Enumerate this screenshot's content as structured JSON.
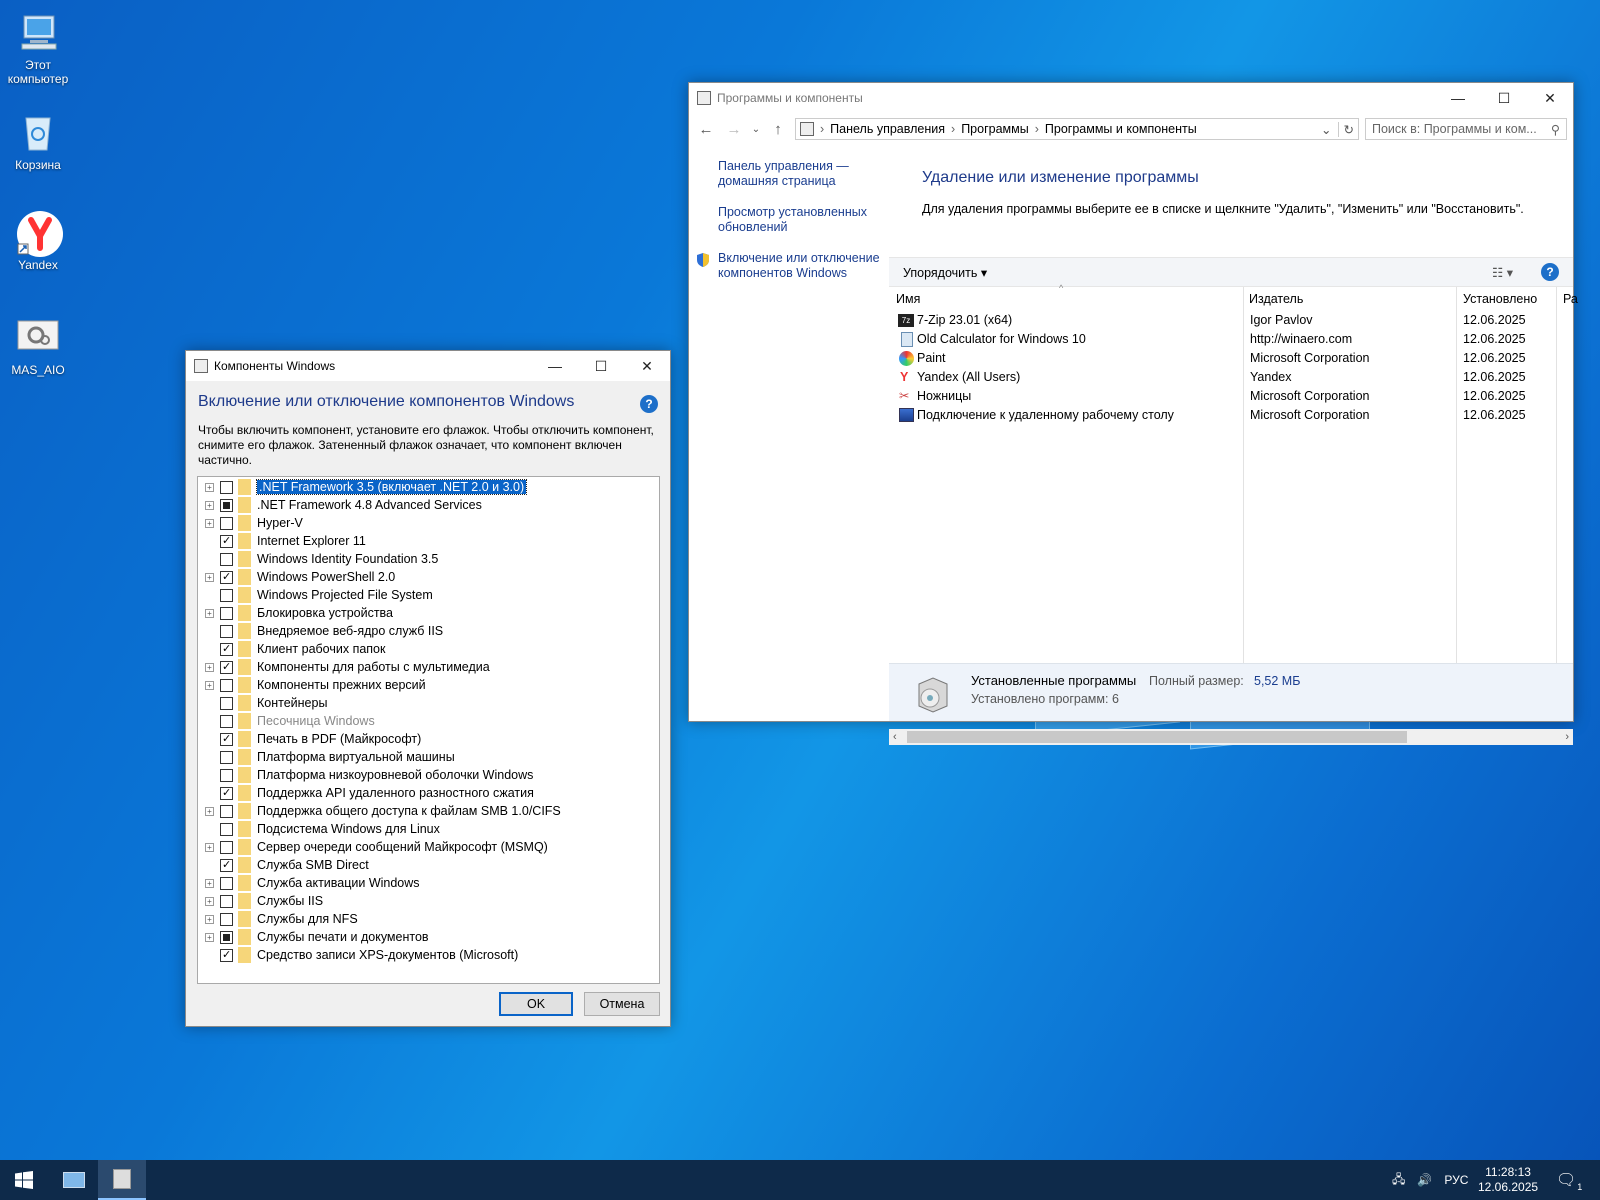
{
  "desktop": {
    "icons": [
      {
        "label": "Этот компьютер",
        "icon": "computer-icon"
      },
      {
        "label": "Корзина",
        "icon": "recycle-bin-icon"
      },
      {
        "label": "Yandex",
        "icon": "yandex-icon"
      },
      {
        "label": "MAS_AIO",
        "icon": "settings-file-icon"
      }
    ]
  },
  "programs_window": {
    "title": "Программы и компоненты",
    "breadcrumb": [
      "Панель управления",
      "Программы",
      "Программы и компоненты"
    ],
    "search_placeholder": "Поиск в: Программы и ком...",
    "left_links": [
      "Панель управления — домашняя страница",
      "Просмотр установленных обновлений",
      "Включение или отключение компонентов Windows"
    ],
    "heading": "Удаление или изменение программы",
    "description": "Для удаления программы выберите ее в списке и щелкните \"Удалить\", \"Изменить\" или \"Восстановить\".",
    "organize_label": "Упорядочить",
    "columns": [
      "Имя",
      "Издатель",
      "Установлено",
      "Ра"
    ],
    "rows": [
      {
        "name": "7-Zip 23.01 (x64)",
        "publisher": "Igor Pavlov",
        "date": "12.06.2025",
        "icon": "7zip-icon"
      },
      {
        "name": "Old Calculator for Windows 10",
        "publisher": "http://winaero.com",
        "date": "12.06.2025",
        "icon": "calculator-icon"
      },
      {
        "name": "Paint",
        "publisher": "Microsoft Corporation",
        "date": "12.06.2025",
        "icon": "paint-icon"
      },
      {
        "name": "Yandex (All Users)",
        "publisher": "Yandex",
        "date": "12.06.2025",
        "icon": "yandex-icon"
      },
      {
        "name": "Ножницы",
        "publisher": "Microsoft Corporation",
        "date": "12.06.2025",
        "icon": "snipping-tool-icon"
      },
      {
        "name": "Подключение к удаленному рабочему столу",
        "publisher": "Microsoft Corporation",
        "date": "12.06.2025",
        "icon": "remote-desktop-icon"
      }
    ],
    "status": {
      "title": "Установленные программы",
      "size_label": "Полный размер:",
      "size_value": "5,52 МБ",
      "count_text": "Установлено программ: 6"
    }
  },
  "features_window": {
    "title": "Компоненты Windows",
    "heading": "Включение или отключение компонентов Windows",
    "description": "Чтобы включить компонент, установите его флажок. Чтобы отключить компонент, снимите его флажок. Затененный флажок означает, что компонент включен частично.",
    "items": [
      {
        "label": ".NET Framework 3.5 (включает .NET 2.0 и 3.0)",
        "expandable": true,
        "state": "unchecked",
        "selected": true
      },
      {
        "label": ".NET Framework 4.8 Advanced Services",
        "expandable": true,
        "state": "partial"
      },
      {
        "label": "Hyper-V",
        "expandable": true,
        "state": "unchecked"
      },
      {
        "label": "Internet Explorer 11",
        "expandable": false,
        "state": "checked"
      },
      {
        "label": "Windows Identity Foundation 3.5",
        "expandable": false,
        "state": "unchecked"
      },
      {
        "label": "Windows PowerShell 2.0",
        "expandable": true,
        "state": "checked"
      },
      {
        "label": "Windows Projected File System",
        "expandable": false,
        "state": "unchecked"
      },
      {
        "label": "Блокировка устройства",
        "expandable": true,
        "state": "unchecked"
      },
      {
        "label": "Внедряемое веб-ядро служб IIS",
        "expandable": false,
        "state": "unchecked"
      },
      {
        "label": "Клиент рабочих папок",
        "expandable": false,
        "state": "checked"
      },
      {
        "label": "Компоненты для работы с мультимедиа",
        "expandable": true,
        "state": "checked"
      },
      {
        "label": "Компоненты прежних версий",
        "expandable": true,
        "state": "unchecked"
      },
      {
        "label": "Контейнеры",
        "expandable": false,
        "state": "unchecked"
      },
      {
        "label": "Песочница Windows",
        "expandable": false,
        "state": "unchecked",
        "disabled": true
      },
      {
        "label": "Печать в PDF (Майкрософт)",
        "expandable": false,
        "state": "checked"
      },
      {
        "label": "Платформа виртуальной машины",
        "expandable": false,
        "state": "unchecked"
      },
      {
        "label": "Платформа низкоуровневой оболочки Windows",
        "expandable": false,
        "state": "unchecked"
      },
      {
        "label": "Поддержка API удаленного разностного сжатия",
        "expandable": false,
        "state": "checked"
      },
      {
        "label": "Поддержка общего доступа к файлам SMB 1.0/CIFS",
        "expandable": true,
        "state": "unchecked"
      },
      {
        "label": "Подсистема Windows для Linux",
        "expandable": false,
        "state": "unchecked"
      },
      {
        "label": "Сервер очереди сообщений Майкрософт (MSMQ)",
        "expandable": true,
        "state": "unchecked"
      },
      {
        "label": "Служба SMB Direct",
        "expandable": false,
        "state": "checked"
      },
      {
        "label": "Служба активации Windows",
        "expandable": true,
        "state": "unchecked"
      },
      {
        "label": "Службы IIS",
        "expandable": true,
        "state": "unchecked"
      },
      {
        "label": "Службы для NFS",
        "expandable": true,
        "state": "unchecked"
      },
      {
        "label": "Службы печати и документов",
        "expandable": true,
        "state": "partial"
      },
      {
        "label": "Средство записи XPS-документов (Microsoft)",
        "expandable": false,
        "state": "checked"
      }
    ],
    "ok_label": "OK",
    "cancel_label": "Отмена"
  },
  "taskbar": {
    "language": "РУС",
    "time": "11:28:13",
    "date": "12.06.2025",
    "notification_count": "1"
  },
  "colors": {
    "accent": "#0a64c8",
    "link": "#1a3d8f",
    "heading": "#1e3a8a",
    "taskbar": "#0e2a4a"
  }
}
